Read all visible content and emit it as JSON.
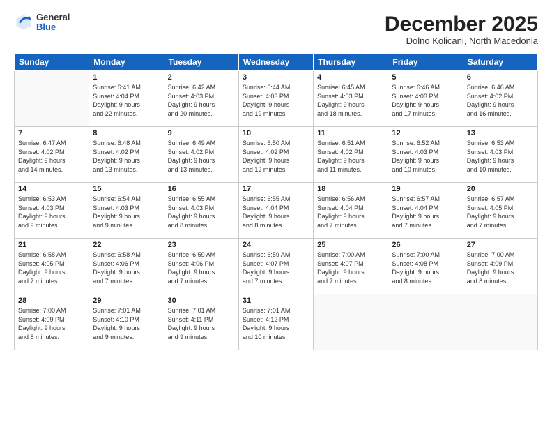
{
  "logo": {
    "general": "General",
    "blue": "Blue"
  },
  "title": "December 2025",
  "subtitle": "Dolno Kolicani, North Macedonia",
  "days_of_week": [
    "Sunday",
    "Monday",
    "Tuesday",
    "Wednesday",
    "Thursday",
    "Friday",
    "Saturday"
  ],
  "weeks": [
    [
      {
        "day": "",
        "info": ""
      },
      {
        "day": "1",
        "info": "Sunrise: 6:41 AM\nSunset: 4:04 PM\nDaylight: 9 hours\nand 22 minutes."
      },
      {
        "day": "2",
        "info": "Sunrise: 6:42 AM\nSunset: 4:03 PM\nDaylight: 9 hours\nand 20 minutes."
      },
      {
        "day": "3",
        "info": "Sunrise: 6:44 AM\nSunset: 4:03 PM\nDaylight: 9 hours\nand 19 minutes."
      },
      {
        "day": "4",
        "info": "Sunrise: 6:45 AM\nSunset: 4:03 PM\nDaylight: 9 hours\nand 18 minutes."
      },
      {
        "day": "5",
        "info": "Sunrise: 6:46 AM\nSunset: 4:03 PM\nDaylight: 9 hours\nand 17 minutes."
      },
      {
        "day": "6",
        "info": "Sunrise: 6:46 AM\nSunset: 4:02 PM\nDaylight: 9 hours\nand 16 minutes."
      }
    ],
    [
      {
        "day": "7",
        "info": "Sunrise: 6:47 AM\nSunset: 4:02 PM\nDaylight: 9 hours\nand 14 minutes."
      },
      {
        "day": "8",
        "info": "Sunrise: 6:48 AM\nSunset: 4:02 PM\nDaylight: 9 hours\nand 13 minutes."
      },
      {
        "day": "9",
        "info": "Sunrise: 6:49 AM\nSunset: 4:02 PM\nDaylight: 9 hours\nand 13 minutes."
      },
      {
        "day": "10",
        "info": "Sunrise: 6:50 AM\nSunset: 4:02 PM\nDaylight: 9 hours\nand 12 minutes."
      },
      {
        "day": "11",
        "info": "Sunrise: 6:51 AM\nSunset: 4:02 PM\nDaylight: 9 hours\nand 11 minutes."
      },
      {
        "day": "12",
        "info": "Sunrise: 6:52 AM\nSunset: 4:03 PM\nDaylight: 9 hours\nand 10 minutes."
      },
      {
        "day": "13",
        "info": "Sunrise: 6:53 AM\nSunset: 4:03 PM\nDaylight: 9 hours\nand 10 minutes."
      }
    ],
    [
      {
        "day": "14",
        "info": "Sunrise: 6:53 AM\nSunset: 4:03 PM\nDaylight: 9 hours\nand 9 minutes."
      },
      {
        "day": "15",
        "info": "Sunrise: 6:54 AM\nSunset: 4:03 PM\nDaylight: 9 hours\nand 9 minutes."
      },
      {
        "day": "16",
        "info": "Sunrise: 6:55 AM\nSunset: 4:03 PM\nDaylight: 9 hours\nand 8 minutes."
      },
      {
        "day": "17",
        "info": "Sunrise: 6:55 AM\nSunset: 4:04 PM\nDaylight: 9 hours\nand 8 minutes."
      },
      {
        "day": "18",
        "info": "Sunrise: 6:56 AM\nSunset: 4:04 PM\nDaylight: 9 hours\nand 7 minutes."
      },
      {
        "day": "19",
        "info": "Sunrise: 6:57 AM\nSunset: 4:04 PM\nDaylight: 9 hours\nand 7 minutes."
      },
      {
        "day": "20",
        "info": "Sunrise: 6:57 AM\nSunset: 4:05 PM\nDaylight: 9 hours\nand 7 minutes."
      }
    ],
    [
      {
        "day": "21",
        "info": "Sunrise: 6:58 AM\nSunset: 4:05 PM\nDaylight: 9 hours\nand 7 minutes."
      },
      {
        "day": "22",
        "info": "Sunrise: 6:58 AM\nSunset: 4:06 PM\nDaylight: 9 hours\nand 7 minutes."
      },
      {
        "day": "23",
        "info": "Sunrise: 6:59 AM\nSunset: 4:06 PM\nDaylight: 9 hours\nand 7 minutes."
      },
      {
        "day": "24",
        "info": "Sunrise: 6:59 AM\nSunset: 4:07 PM\nDaylight: 9 hours\nand 7 minutes."
      },
      {
        "day": "25",
        "info": "Sunrise: 7:00 AM\nSunset: 4:07 PM\nDaylight: 9 hours\nand 7 minutes."
      },
      {
        "day": "26",
        "info": "Sunrise: 7:00 AM\nSunset: 4:08 PM\nDaylight: 9 hours\nand 8 minutes."
      },
      {
        "day": "27",
        "info": "Sunrise: 7:00 AM\nSunset: 4:09 PM\nDaylight: 9 hours\nand 8 minutes."
      }
    ],
    [
      {
        "day": "28",
        "info": "Sunrise: 7:00 AM\nSunset: 4:09 PM\nDaylight: 9 hours\nand 8 minutes."
      },
      {
        "day": "29",
        "info": "Sunrise: 7:01 AM\nSunset: 4:10 PM\nDaylight: 9 hours\nand 9 minutes."
      },
      {
        "day": "30",
        "info": "Sunrise: 7:01 AM\nSunset: 4:11 PM\nDaylight: 9 hours\nand 9 minutes."
      },
      {
        "day": "31",
        "info": "Sunrise: 7:01 AM\nSunset: 4:12 PM\nDaylight: 9 hours\nand 10 minutes."
      },
      {
        "day": "",
        "info": ""
      },
      {
        "day": "",
        "info": ""
      },
      {
        "day": "",
        "info": ""
      }
    ]
  ]
}
